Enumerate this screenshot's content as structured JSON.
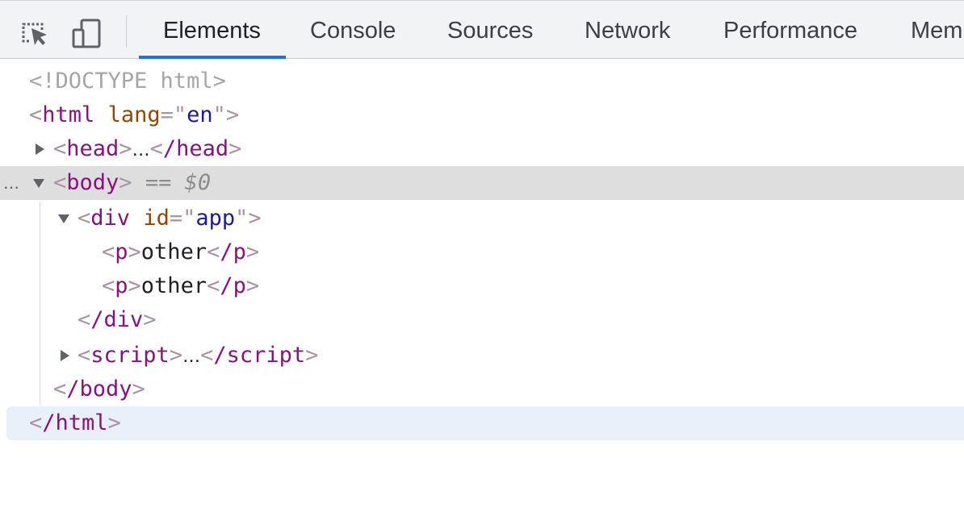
{
  "toolbar": {
    "icons": [
      "inspect-element-icon",
      "device-toolbar-icon"
    ],
    "tabs": [
      "Elements",
      "Console",
      "Sources",
      "Network",
      "Performance",
      "Mem"
    ],
    "active_tab": "Elements",
    "accent_color": "#1a73e8"
  },
  "tree": {
    "doctype": "<!DOCTYPE html>",
    "html_open": {
      "tag": "html",
      "attr_name": "lang",
      "attr_value": "en"
    },
    "head": {
      "open": "head",
      "ellipsis": "…",
      "close": "/head"
    },
    "body": {
      "tag": "body",
      "eq": "==",
      "ref": "$0",
      "dots": "…"
    },
    "div": {
      "tag": "div",
      "attr_name": "id",
      "attr_value": "app"
    },
    "p1": {
      "tag": "p",
      "text": "other",
      "close": "/p"
    },
    "p2": {
      "tag": "p",
      "text": "other",
      "close": "/p"
    },
    "div_close": "/div",
    "script": {
      "open": "script",
      "ellipsis": "…",
      "close": "/script"
    },
    "body_close": "/body",
    "html_close": "/html"
  }
}
